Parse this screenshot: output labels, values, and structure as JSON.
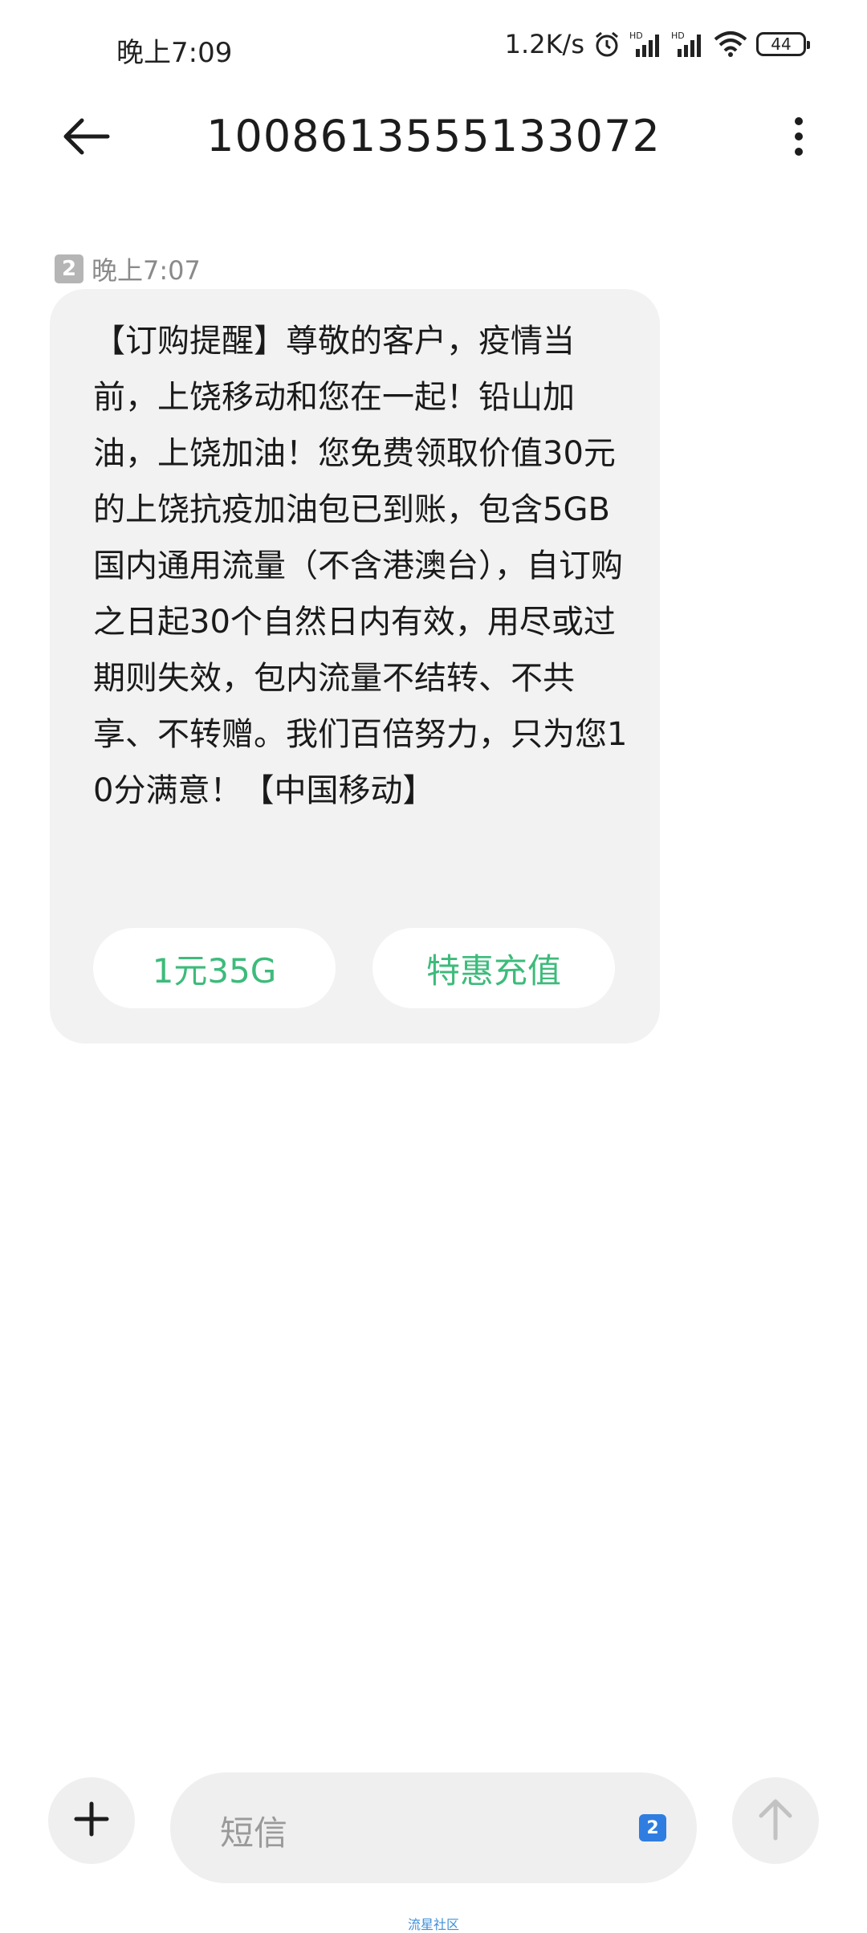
{
  "status_bar": {
    "time": "晚上7:09",
    "net_speed": "1.2K/s",
    "battery": "44",
    "icons": [
      "alarm-icon",
      "hd-signal-icon",
      "hd-signal-icon",
      "wifi-icon",
      "battery-icon"
    ]
  },
  "header": {
    "title": "1008613555133072",
    "back_icon": "arrow-left-icon",
    "more_icon": "more-vertical-icon"
  },
  "message": {
    "sim_slot": "2",
    "time": "晚上7:07",
    "text": "【订购提醒】尊敬的客户，疫情当前，上饶移动和您在一起！铅山加油，上饶加油！您免费领取价值30元的上饶抗疫加油包已到账，包含5GB国内通用流量（不含港澳台），自订购之日起30个自然日内有效，用尽或过期则失效，包内流量不结转、不共享、不转赠。我们百倍努力，只为您10分满意！【中国移动】",
    "actions": [
      {
        "label": "1元35G"
      },
      {
        "label": "特惠充值"
      }
    ]
  },
  "input_bar": {
    "placeholder": "短信",
    "sim_slot": "2",
    "add_icon": "plus-icon",
    "send_icon": "arrow-up-icon"
  },
  "watermark": "流星社区",
  "colors": {
    "accent_green": "#3dbb7b",
    "bubble_bg": "#f2f2f2",
    "sim_blue": "#2f7de1"
  }
}
